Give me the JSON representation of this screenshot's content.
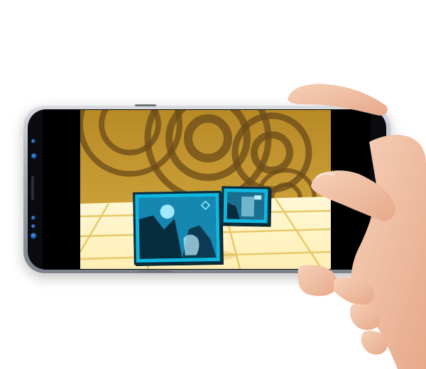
{
  "scene": {
    "device": "smartphone",
    "orientation": "landscape",
    "content": "game-scene",
    "colors": {
      "background": "#ffffff",
      "phone_frame": "#a8adb6",
      "screen_sky": "#c79a2a",
      "screen_rings": "#6b4b1a",
      "floor": "#fff4c6",
      "floor_lines": "#e7c86a",
      "photo_frame": "#0fb7df",
      "skin": "#f2c2a8"
    },
    "icons": [
      "phone-icon",
      "photo-frame-icon",
      "hand-icon"
    ]
  }
}
